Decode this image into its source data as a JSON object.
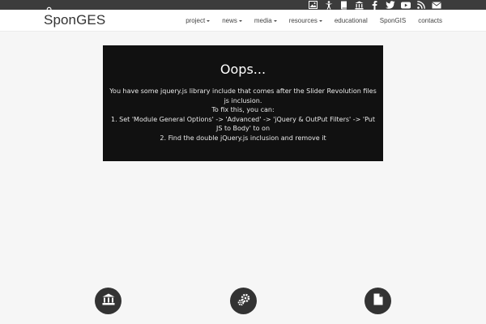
{
  "brand": {
    "logo": "SponGES"
  },
  "topbar": {
    "search_icon": "search-icon",
    "social_icons": [
      "image-icon",
      "accessibility-icon",
      "book-icon",
      "institution-icon",
      "facebook-icon",
      "twitter-icon",
      "youtube-icon",
      "rss-icon",
      "mail-icon"
    ]
  },
  "nav": {
    "project": "project",
    "news": "news",
    "media": "media",
    "resources": "resources",
    "educational": "educational",
    "spongis": "SponGIS",
    "contacts": "contacts"
  },
  "error": {
    "title": "Oops...",
    "line1": "You have some jquery.js library include that comes after the Slider Revolution files js inclusion.",
    "line2": "To fix this, you can:",
    "line3": "1. Set 'Module General Options' -> 'Advanced' -> 'jQuery & OutPut Filters' -> 'Put JS to Body' to on",
    "line4": "2. Find the double jQuery.js inclusion and remove it"
  },
  "features": {
    "icons": [
      "institution-icon",
      "gears-icon",
      "document-icon"
    ]
  },
  "colors": {
    "topbar": "#3c3c3c",
    "error_bg": "#111111",
    "circle": "#333333",
    "page_bg": "#f6f6f6"
  }
}
